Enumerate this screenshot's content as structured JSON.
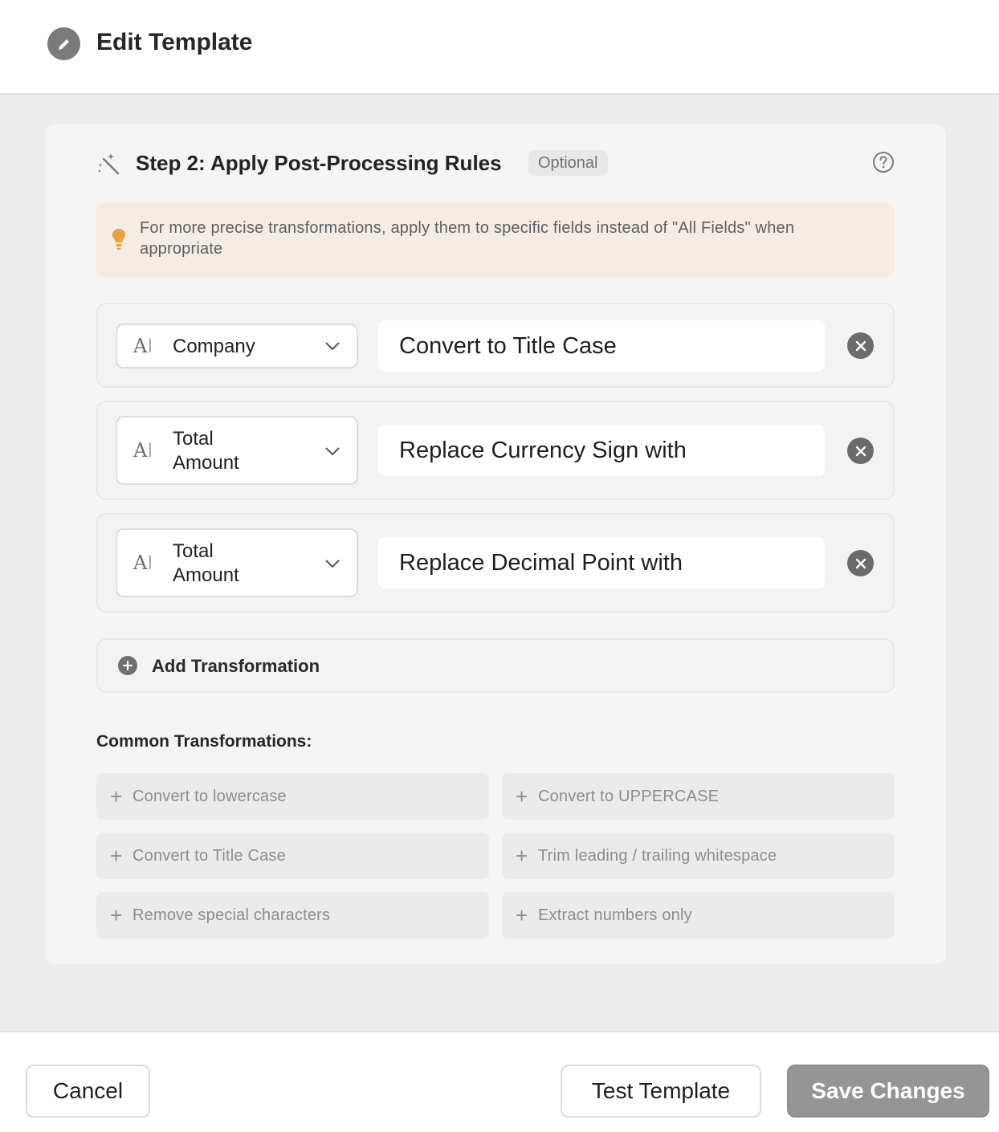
{
  "header": {
    "title": "Edit Template",
    "icon": "pencil-icon"
  },
  "step": {
    "title": "Step 2: Apply Post-Processing Rules",
    "badge": "Optional",
    "tip": "For more precise transformations, apply them to specific fields instead of \"All Fields\" when appropriate"
  },
  "rules": [
    {
      "field_line1": "Company",
      "field_line2": "",
      "transformation": "Convert to Title Case"
    },
    {
      "field_line1": "Total",
      "field_line2": "Amount",
      "transformation": "Replace Currency Sign with"
    },
    {
      "field_line1": "Total",
      "field_line2": "Amount",
      "transformation": "Replace Decimal Point with"
    }
  ],
  "add_transformation_label": "Add Transformation",
  "common": {
    "title": "Common Transformations:",
    "items": [
      "Convert to lowercase",
      "Convert to UPPERCASE",
      "Convert to Title Case",
      "Trim leading / trailing whitespace",
      "Remove special characters",
      "Extract numbers only"
    ]
  },
  "footer": {
    "cancel_label": "Cancel",
    "test_label": "Test Template",
    "save_label": "Save Changes"
  },
  "colors": {
    "tip_background": "#f5ece6",
    "tip_icon": "#e8a33a",
    "save_button": "#959595"
  }
}
